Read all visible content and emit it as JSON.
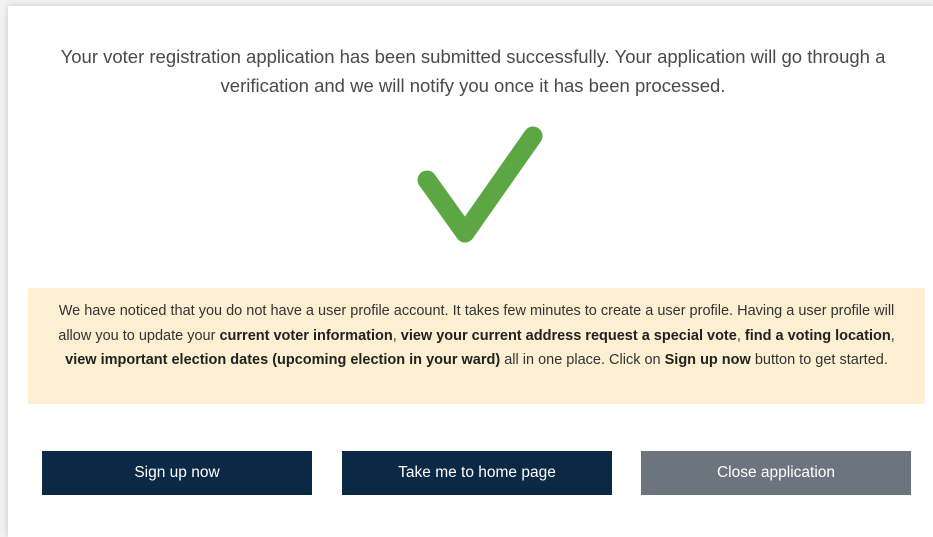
{
  "success_message": "Your voter registration application has been submitted successfully. Your application will go through a verification and we will notify you once it has been processed.",
  "success_icon": "check-mark-icon",
  "notice": {
    "t1": "We have noticed that you do not have a user profile account. It takes few minutes to create a user profile. Having a user profile will allow you to update your ",
    "b1": "current voter information",
    "t2": ", ",
    "b2": "view your current address request a special vote",
    "t3": ", ",
    "b3": "find a voting location",
    "t4": ", ",
    "b4": "view important election dates (upcoming election in your ward)",
    "t5": " all in one place. Click on ",
    "b5": "Sign up now",
    "t6": " button to get started."
  },
  "buttons": {
    "sign_up": "Sign up now",
    "home": "Take me to home page",
    "close": "Close application"
  },
  "colors": {
    "check": "#5ca744",
    "notice_bg": "#fdefd2",
    "primary_button": "#0b2844",
    "secondary_button": "#6c757d"
  }
}
